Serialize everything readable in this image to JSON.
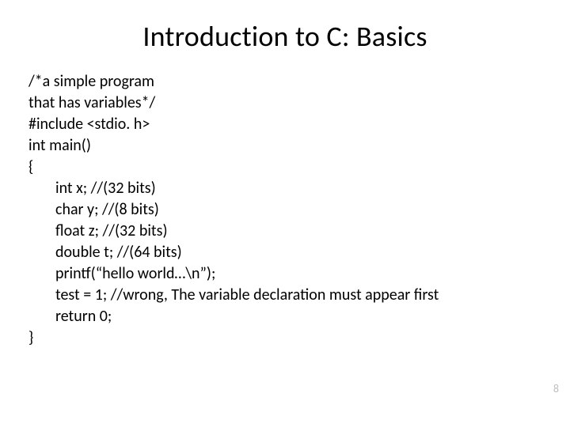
{
  "title": "Introduction to C: Basics",
  "code": {
    "l1": "/*a simple program",
    "l2": "that has variables*/",
    "l3": "#include <stdio. h>",
    "l4": "int main()",
    "l5": "{",
    "l6": "int x; //(32 bits)",
    "l7": "char y; //(8 bits)",
    "l8": "float z; //(32 bits)",
    "l9": "double t; //(64 bits)",
    "l10": "printf(“hello world…\\n”);",
    "l11": "test = 1; //wrong, The variable declaration must appear first",
    "l12": "return 0;",
    "l13": "}"
  },
  "page_number": "8"
}
